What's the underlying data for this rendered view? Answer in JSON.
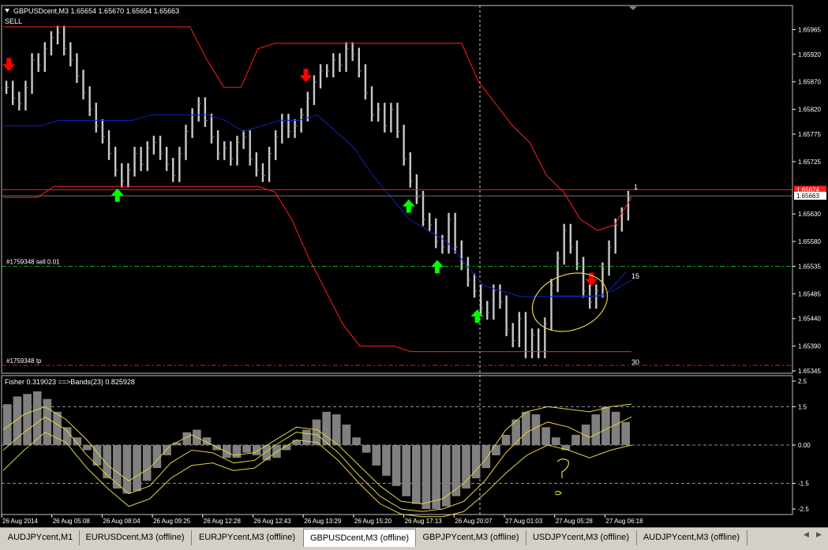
{
  "header": {
    "symbol_info": "GBPUSDcent,M3  1.65654 1.65670 1.65654 1.65663",
    "signal": "SELL"
  },
  "chart_data": [
    {
      "type": "bar",
      "title": "GBPUSDcent,M3",
      "ylim": [
        1.65345,
        1.6599
      ],
      "y_ticks": [
        "1.65965",
        "1.65920",
        "1.65870",
        "1.65820",
        "1.65775",
        "1.65725",
        "1.65630",
        "1.65580",
        "1.65535",
        "1.65485",
        "1.65440",
        "1.65390",
        "1.65345"
      ],
      "x_ticks": [
        "26 Aug 2014",
        "26 Aug 05:08",
        "26 Aug 08:04",
        "26 Aug 09:25",
        "26 Aug 12:28",
        "26 Aug 12:43",
        "26 Aug 13:29",
        "26 Aug 15:20",
        "26 Aug 17:13",
        "26 Aug 20:07",
        "27 Aug 01:03",
        "27 Aug 05:28",
        "27 Aug 06:18"
      ],
      "price_closes": [
        1.6586,
        1.6584,
        1.6583,
        1.6586,
        1.6591,
        1.659,
        1.6593,
        1.6595,
        1.6596,
        1.6593,
        1.6591,
        1.6588,
        1.6585,
        1.6582,
        1.6579,
        1.6577,
        1.6574,
        1.6571,
        1.6569,
        1.6571,
        1.6574,
        1.6572,
        1.6575,
        1.6576,
        1.6574,
        1.6572,
        1.657,
        1.6574,
        1.6578,
        1.6581,
        1.6583,
        1.658,
        1.6577,
        1.6574,
        1.6575,
        1.6573,
        1.6576,
        1.6577,
        1.6573,
        1.6571,
        1.657,
        1.6574,
        1.6577,
        1.658,
        1.6578,
        1.6579,
        1.6581,
        1.6584,
        1.6587,
        1.6589,
        1.6589,
        1.6591,
        1.659,
        1.6593,
        1.6592,
        1.6589,
        1.6585,
        1.6581,
        1.6582,
        1.6579,
        1.6582,
        1.6578,
        1.6573,
        1.6569,
        1.6566,
        1.6562,
        1.6561,
        1.6558,
        1.6557,
        1.6562,
        1.6557,
        1.6554,
        1.6551,
        1.6549,
        1.6546,
        1.6545,
        1.6549,
        1.6547,
        1.6542,
        1.654,
        1.6544,
        1.6538,
        1.6541,
        1.6538,
        1.6543,
        1.655,
        1.6555,
        1.656,
        1.6557,
        1.6554,
        1.6549,
        1.6547,
        1.6549,
        1.6553,
        1.6557,
        1.6561,
        1.6563,
        1.6566
      ],
      "series": [
        {
          "name": "",
          "color": "#ff2020",
          "values": [
            1.6597,
            1.6597,
            1.6597,
            1.6597,
            1.6597,
            1.6597,
            1.6597,
            1.6597,
            1.6597,
            1.6597,
            1.6597,
            1.6597,
            1.6591,
            1.6586,
            1.6586,
            1.6593,
            1.6594,
            1.6594,
            1.6594,
            1.6594,
            1.6594,
            1.6594,
            1.6594,
            1.6594,
            1.6594,
            1.6594,
            1.6594,
            1.6594,
            1.6587,
            1.6583,
            1.6579,
            1.6576,
            1.657,
            1.6567,
            1.6562,
            1.656,
            1.6561,
            1.6566
          ]
        },
        {
          "name": "",
          "color": "#ff2020",
          "values": [
            1.6566,
            1.6566,
            1.6566,
            1.6568,
            1.6568,
            1.6568,
            1.6568,
            1.6568,
            1.6568,
            1.6568,
            1.6568,
            1.6568,
            1.6568,
            1.6568,
            1.6568,
            1.6568,
            1.6567,
            1.6562,
            1.6555,
            1.6549,
            1.6543,
            1.6539,
            1.6539,
            1.6539,
            1.6538,
            1.6538,
            1.6538,
            1.6538,
            1.6538,
            1.6538,
            1.6538,
            1.6538,
            1.6538,
            1.6538,
            1.6538,
            1.6538,
            1.6538,
            1.6538
          ]
        },
        {
          "name": "",
          "color": "#1020c0",
          "values": [
            1.6579,
            1.6579,
            1.6579,
            1.658,
            1.658,
            1.658,
            1.658,
            1.658,
            1.6581,
            1.6581,
            1.6581,
            1.6581,
            1.658,
            1.6578,
            1.6579,
            1.658,
            1.658,
            1.6581,
            1.6578,
            1.6575,
            1.657,
            1.6566,
            1.6562,
            1.656,
            1.6558,
            1.6554,
            1.655,
            1.6549,
            1.6548,
            1.6548,
            1.6548,
            1.6548,
            1.6548,
            1.6549,
            1.6551
          ]
        }
      ],
      "horizontal_lines": [
        {
          "label": "",
          "value": 1.65674,
          "color": "#ff2020",
          "axis_tag": "1.65674"
        },
        {
          "label": "",
          "value": 1.65663,
          "color": "#808080",
          "axis_tag": "1.65663"
        },
        {
          "label": "#1759348 sell 0.01",
          "value": 1.65535,
          "color": "#20c020"
        },
        {
          "label": "#1759348 tp",
          "value": 1.65355,
          "color": "#ff2020"
        }
      ],
      "annotations": [
        "1",
        "15",
        "30"
      ],
      "arrows": [
        {
          "direction": "down",
          "color": "#ff0000",
          "bar": 1
        },
        {
          "direction": "up",
          "color": "#00ff00",
          "bar": 20
        },
        {
          "direction": "down",
          "color": "#ff0000",
          "bar": 53
        },
        {
          "direction": "up",
          "color": "#00ff00",
          "bar": 71
        },
        {
          "direction": "up",
          "color": "#00ff00",
          "bar": 76
        },
        {
          "direction": "up",
          "color": "#00ff00",
          "bar": 83
        },
        {
          "direction": "down",
          "color": "#ff0000",
          "bar": 103
        }
      ]
    },
    {
      "type": "bar",
      "title": "Fisher 0.319023 ==>Bands(23) 0.825928",
      "ylim": [
        -2.5,
        2.5
      ],
      "y_ticks": [
        "2.5",
        "1.5",
        "0.00",
        "-1.5",
        "-2.5"
      ],
      "histogram": [
        1.6,
        1.9,
        2.0,
        2.1,
        1.8,
        1.3,
        0.7,
        0.3,
        -0.2,
        -0.8,
        -1.3,
        -1.7,
        -1.9,
        -1.8,
        -1.4,
        -0.9,
        -0.4,
        0.1,
        0.5,
        0.6,
        0.3,
        -0.2,
        -0.5,
        -0.5,
        -0.3,
        -0.4,
        -0.6,
        -0.5,
        -0.2,
        0.2,
        0.6,
        1.0,
        1.3,
        1.2,
        0.8,
        0.3,
        -0.3,
        -0.8,
        -1.2,
        -1.6,
        -2.0,
        -2.3,
        -2.5,
        -2.5,
        -2.4,
        -2.0,
        -1.7,
        -1.3,
        -0.9,
        -0.4,
        0.4,
        1.0,
        1.3,
        1.2,
        0.7,
        0.3,
        -0.2,
        0.4,
        0.8,
        1.2,
        1.5,
        1.3,
        0.9
      ],
      "bands": [
        {
          "values": [
            0.6,
            1.2,
            1.5,
            1.0,
            0.2,
            -0.8,
            -1.4,
            -0.9,
            0.0,
            0.4,
            0.0,
            -0.4,
            -0.3,
            0.2,
            0.7,
            0.6,
            0.0,
            -0.8,
            -1.6,
            -2.2,
            -2.3,
            -2.1,
            -1.5,
            -0.6,
            0.6,
            1.3,
            1.5,
            1.4,
            1.3,
            1.5,
            1.6
          ]
        },
        {
          "values": [
            -0.2,
            0.5,
            1.1,
            0.6,
            -0.4,
            -1.2,
            -1.9,
            -1.6,
            -0.7,
            -0.2,
            -0.3,
            -0.7,
            -0.6,
            0.0,
            0.5,
            0.4,
            -0.3,
            -1.2,
            -2.0,
            -2.5,
            -2.6,
            -2.5,
            -2.2,
            -1.4,
            -0.3,
            0.5,
            0.9,
            0.7,
            0.3,
            0.7,
            1.1
          ]
        },
        {
          "values": [
            -1.0,
            -0.2,
            0.5,
            0.1,
            -0.9,
            -1.7,
            -2.4,
            -2.1,
            -1.3,
            -0.8,
            -0.7,
            -1.0,
            -0.9,
            -0.3,
            0.2,
            0.1,
            -0.6,
            -1.5,
            -2.3,
            -2.7,
            -2.8,
            -2.8,
            -2.6,
            -1.9,
            -1.1,
            -0.4,
            0.0,
            -0.2,
            -0.5,
            -0.2,
            0.0
          ]
        }
      ]
    }
  ],
  "tabs": [
    {
      "label": "AUDJPYcent,M1",
      "active": false
    },
    {
      "label": "EURUSDcent,M3 (offline)",
      "active": false
    },
    {
      "label": "EURJPYcent,M3 (offline)",
      "active": false
    },
    {
      "label": "GBPUSDcent,M3 (offline)",
      "active": true
    },
    {
      "label": "GBPJPYcent,M3 (offline)",
      "active": false
    },
    {
      "label": "USDJPYcent,M3 (offline)",
      "active": false
    },
    {
      "label": "AUDJPYcent,M3 (offline)",
      "active": false
    }
  ],
  "colors": {
    "background": "#000000",
    "bars": "#c8c8c8",
    "axis": "#ffffff",
    "grid": "#ffffff",
    "band": "#e8d040",
    "histogram": "#808080"
  }
}
